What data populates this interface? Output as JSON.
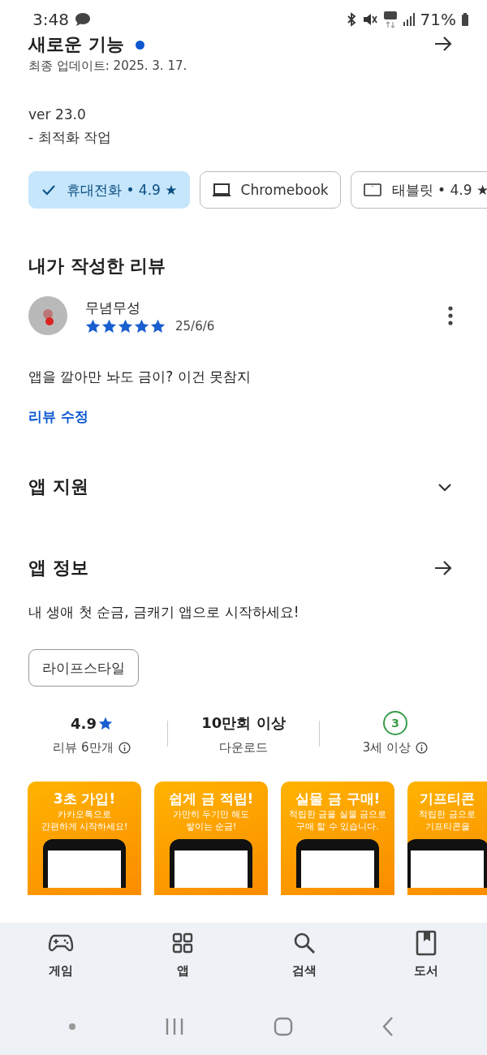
{
  "status_bar": {
    "time": "3:48",
    "battery": "71%"
  },
  "whats_new": {
    "title": "새로운 기능",
    "unread": true,
    "updated": "최종 업데이트: 2025. 3. 17.",
    "notes": [
      "ver 23.0",
      "- 최적화 작업"
    ]
  },
  "device_chips": [
    {
      "label": "휴대전화 • 4.9 ★",
      "selected": true
    },
    {
      "kind": "laptop",
      "label": "Chromebook",
      "selected": false
    },
    {
      "kind": "tablet",
      "label": "태블릿 • 4.9 ★",
      "selected": false
    }
  ],
  "my_review": {
    "heading": "내가 작성한 리뷰",
    "author": "무념무성",
    "stars": 5,
    "date": "25/6/6",
    "text": "앱을 깔아만 놔도 금이? 이건 못참지",
    "edit_link": "리뷰 수정"
  },
  "app_support": {
    "title": "앱 지원",
    "expanded": false
  },
  "app_info": {
    "title": "앱 정보",
    "description": "내 생애 첫 순금, 금캐기 앱으로 시작하세요!",
    "category": "라이프스타일"
  },
  "stats": [
    {
      "kind": "rating",
      "value": "4.9",
      "label": "리뷰 6만개"
    },
    {
      "kind": "downloads",
      "value": "10만회 이상",
      "label": "다운로드"
    },
    {
      "kind": "age",
      "value": "3",
      "label": "3세 이상"
    }
  ],
  "screenshots": [
    {
      "headline": "3초 가입!",
      "caption": [
        "카카오톡으로",
        "간편하게 시작하세요!"
      ]
    },
    {
      "headline": "쉽게 금 적립!",
      "caption": [
        "가만히 두기만 해도",
        "쌓이는 순금!"
      ]
    },
    {
      "headline": "실물 금 구매!",
      "caption": [
        "적립한 금을 실물 금으로",
        "구매 할 수 있습니다."
      ]
    },
    {
      "headline": "기프티콘",
      "caption": [
        "적립한 금으로",
        "기프티콘을"
      ]
    }
  ],
  "bottom_nav": [
    {
      "kind": "games",
      "label": "게임",
      "selected": false
    },
    {
      "kind": "apps",
      "label": "앱",
      "selected": false
    },
    {
      "kind": "search",
      "label": "검색",
      "selected": false
    },
    {
      "kind": "books",
      "label": "도서",
      "selected": false
    }
  ]
}
